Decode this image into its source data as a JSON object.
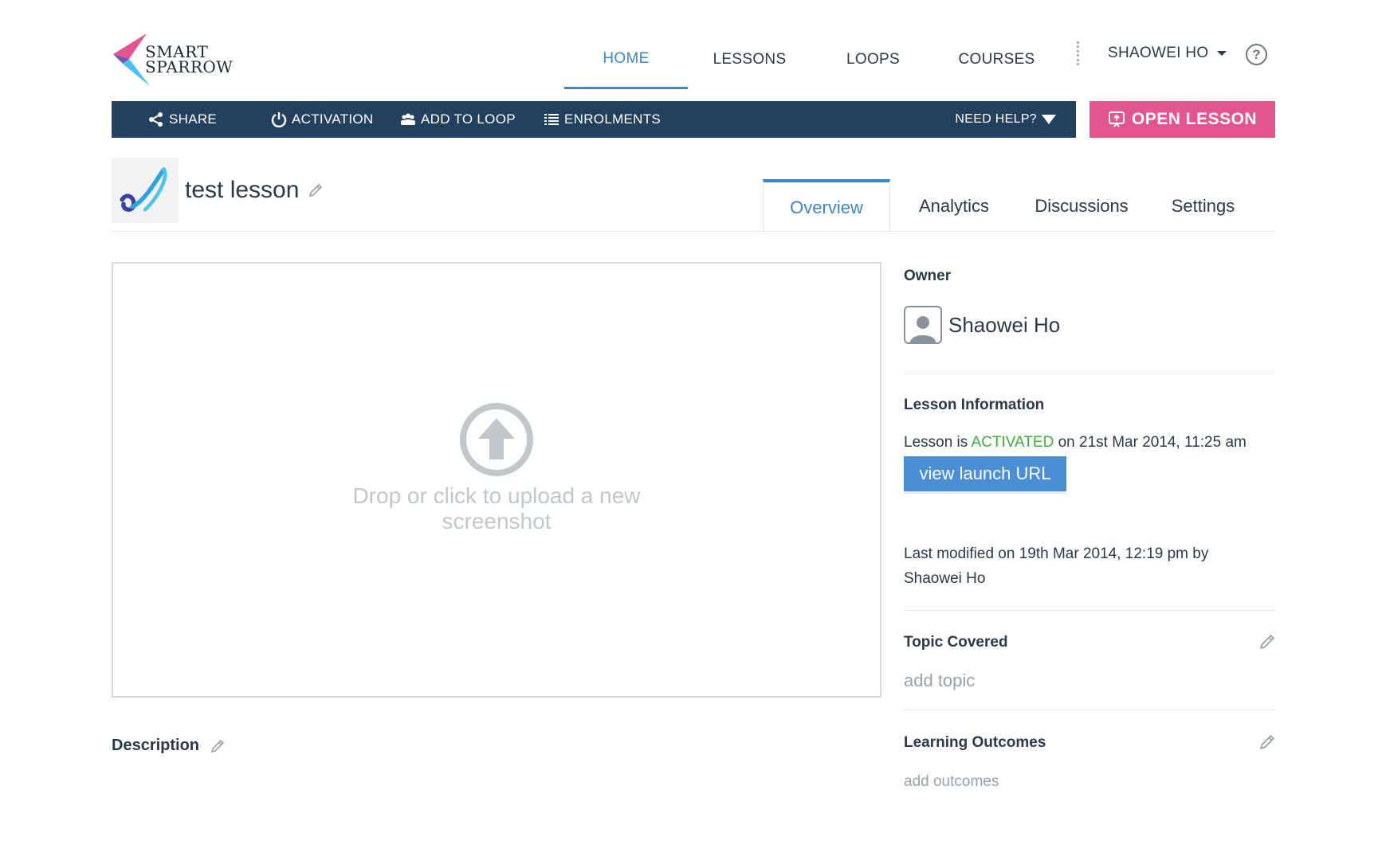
{
  "brand": {
    "line1": "SMART",
    "line2": "SPARROW",
    "accent_pink": "#e2558f",
    "accent_blue": "#3f86c8"
  },
  "topnav": {
    "items": [
      {
        "label": "HOME",
        "active": true
      },
      {
        "label": "LESSONS",
        "active": false
      },
      {
        "label": "LOOPS",
        "active": false
      },
      {
        "label": "COURSES",
        "active": false
      }
    ],
    "user": "SHAOWEI HO",
    "help_icon": "question-circle-icon"
  },
  "actionbar": {
    "share": "SHARE",
    "activation": "ACTIVATION",
    "add_to_loop": "ADD TO LOOP",
    "enrolments": "ENROLMENTS",
    "need_help": "NEED HELP?",
    "open_lesson": "OPEN LESSON",
    "bar_color": "#24405f"
  },
  "lesson": {
    "title": "test lesson"
  },
  "tabs": [
    {
      "label": "Overview",
      "active": true
    },
    {
      "label": "Analytics",
      "active": false
    },
    {
      "label": "Discussions",
      "active": false
    },
    {
      "label": "Settings",
      "active": false
    }
  ],
  "upload": {
    "text": "Drop or click to upload a new screenshot"
  },
  "description": {
    "label": "Description"
  },
  "sidebar": {
    "owner_label": "Owner",
    "owner_name": "Shaowei Ho",
    "lesson_info_label": "Lesson Information",
    "status_prefix": "Lesson is",
    "status": "ACTIVATED",
    "status_suffix": "on 21st Mar 2014, 11:25 am",
    "view_launch_url": "view launch URL",
    "last_modified": "Last modified on 19th Mar 2014, 12:19 pm by",
    "last_modified_by": "Shaowei Ho",
    "topic_label": "Topic Covered",
    "add_topic": "add topic",
    "outcomes_label": "Learning Outcomes",
    "add_outcomes": "add outcomes"
  }
}
